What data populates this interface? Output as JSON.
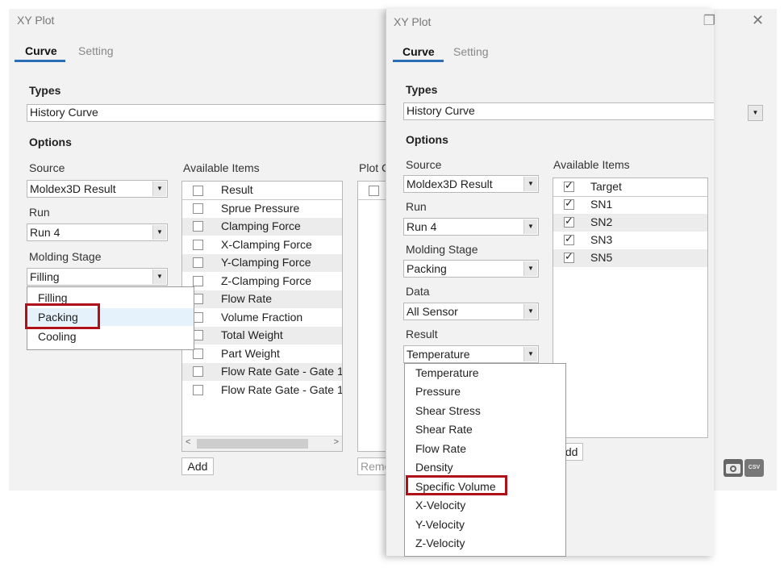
{
  "win1": {
    "title": "XY Plot",
    "tabs": [
      "Curve",
      "Setting"
    ],
    "types_heading": "Types",
    "types_value": "History Curve",
    "options_heading": "Options",
    "source_label": "Source",
    "source_value": "Moldex3D Result",
    "run_label": "Run",
    "run_value": "Run 4",
    "stage_label": "Molding Stage",
    "stage_value": "Filling",
    "stage_options": [
      "Filling",
      "Packing",
      "Cooling"
    ],
    "available_label": "Available Items",
    "list_header": "Result",
    "items": [
      "Sprue Pressure",
      "Clamping Force",
      "X-Clamping Force",
      "Y-Clamping Force",
      "Z-Clamping Force",
      "Flow Rate",
      "Volume Fraction",
      "Total Weight",
      "Part Weight",
      "Flow Rate Gate - Gate 1",
      "Flow Rate Gate - Gate 1"
    ],
    "add_label": "Add",
    "plot_label": "Plot Curves",
    "remove_label": "Remove"
  },
  "win2": {
    "title": "XY Plot",
    "close_glyph": "✕",
    "restore_glyph": "❐",
    "tabs": [
      "Curve",
      "Setting"
    ],
    "types_heading": "Types",
    "types_value": "History Curve",
    "options_heading": "Options",
    "source_label": "Source",
    "source_value": "Moldex3D Result",
    "run_label": "Run",
    "run_value": "Run 4",
    "stage_label": "Molding Stage",
    "stage_value": "Packing",
    "data_label": "Data",
    "data_value": "All Sensor",
    "result_label": "Result",
    "result_value": "Temperature",
    "result_options": [
      "Temperature",
      "Pressure",
      "Shear Stress",
      "Shear Rate",
      "Flow Rate",
      "Density",
      "Specific Volume",
      "X-Velocity",
      "Y-Velocity",
      "Z-Velocity"
    ],
    "available_label": "Available Items",
    "list_header": "Target",
    "targets": [
      "SN1",
      "SN2",
      "SN3",
      "SN5"
    ],
    "add_label": "Add",
    "csv_label": "CSV"
  },
  "colors": {
    "highlight": "#b0101a",
    "tab_underline": "#2a6fb5",
    "window_bg": "#f2f2f2"
  },
  "icons": [
    "dropdown-arrow-icon",
    "close-icon",
    "restore-icon",
    "camera-icon",
    "csv-icon"
  ]
}
